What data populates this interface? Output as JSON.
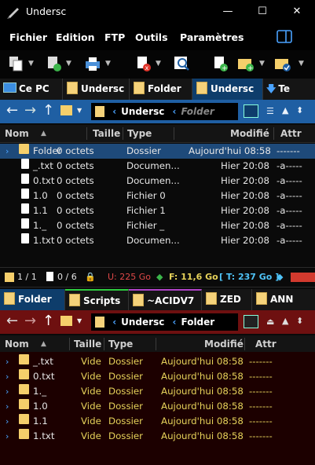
{
  "window": {
    "title": "Undersc",
    "min": "—",
    "max": "☐",
    "close": "✕"
  },
  "menu": [
    "Fichier",
    "Edition",
    "FTP",
    "Outils",
    "Paramètres"
  ],
  "tabs_top": [
    "Ce PC",
    "Undersc",
    "Folder",
    "Undersc",
    "Te"
  ],
  "top_pane": {
    "crumbs": {
      "first": "Undersc",
      "second": "Folder"
    },
    "columns": [
      "Nom",
      "Taille",
      "Type",
      "Modifié",
      "Attr"
    ],
    "rows": [
      {
        "name": "Folder",
        "size": "0 octets",
        "type": "Dossier",
        "modified": "Aujourd'hui  08:58",
        "attr": "-------",
        "kind": "folder"
      },
      {
        "name": "_.txt",
        "size": "0 octets",
        "type": "Documen...",
        "modified": "Hier  20:08",
        "attr": "-a-----",
        "kind": "file"
      },
      {
        "name": "0.txt",
        "size": "0 octets",
        "type": "Documen...",
        "modified": "Hier  20:08",
        "attr": "-a-----",
        "kind": "file"
      },
      {
        "name": "1.0",
        "size": "0 octets",
        "type": "Fichier 0",
        "modified": "Hier  20:08",
        "attr": "-a-----",
        "kind": "file"
      },
      {
        "name": "1.1",
        "size": "0 octets",
        "type": "Fichier 1",
        "modified": "Hier  20:08",
        "attr": "-a-----",
        "kind": "file"
      },
      {
        "name": "1._",
        "size": "0 octets",
        "type": "Fichier _",
        "modified": "Hier  20:08",
        "attr": "-a-----",
        "kind": "file"
      },
      {
        "name": "1.txt",
        "size": "0 octets",
        "type": "Documen...",
        "modified": "Hier  20:08",
        "attr": "-a-----",
        "kind": "file"
      }
    ]
  },
  "status": {
    "items": "1 / 1",
    "files": "0 / 6",
    "used": "U: 225 Go",
    "free": "F: 11,6 Go",
    "total": "[ T: 237 Go ]",
    "colors": {
      "used": "#e04848",
      "free": "#e6d25a",
      "total": "#4fc3f7"
    }
  },
  "tabs_bottom": [
    "Folder",
    "Scripts",
    "~ACIDV7",
    "ZED",
    "ANN"
  ],
  "bottom_pane": {
    "crumbs": {
      "first": "Undersc",
      "second": "Folder"
    },
    "columns": [
      "Nom",
      "Taille",
      "Type",
      "Modifié",
      "Attr"
    ],
    "rows": [
      {
        "name": "_.txt",
        "size": "Vide",
        "type": "Dossier",
        "modified": "Aujourd'hui  08:58",
        "attr": "-------"
      },
      {
        "name": "0.txt",
        "size": "Vide",
        "type": "Dossier",
        "modified": "Aujourd'hui  08:58",
        "attr": "-------"
      },
      {
        "name": "1._",
        "size": "Vide",
        "type": "Dossier",
        "modified": "Aujourd'hui  08:58",
        "attr": "-------"
      },
      {
        "name": "1.0",
        "size": "Vide",
        "type": "Dossier",
        "modified": "Aujourd'hui  08:58",
        "attr": "-------"
      },
      {
        "name": "1.1",
        "size": "Vide",
        "type": "Dossier",
        "modified": "Aujourd'hui  08:58",
        "attr": "-------"
      },
      {
        "name": "1.txt",
        "size": "Vide",
        "type": "Dossier",
        "modified": "Aujourd'hui  08:58",
        "attr": "-------"
      }
    ]
  }
}
